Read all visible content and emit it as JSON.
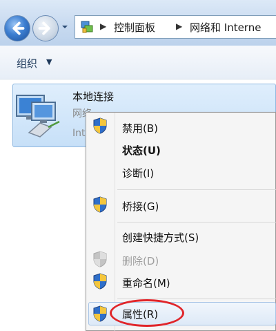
{
  "address_bar": {
    "crumbs": [
      "控制面板",
      "网络和 Interne"
    ]
  },
  "toolbar": {
    "organize_label": "组织"
  },
  "connection": {
    "name": "本地连接",
    "line1": "网络",
    "line2": "Int"
  },
  "context_menu": {
    "items": [
      {
        "label": "禁用(B)",
        "icon": "uac-shield-icon",
        "bold": false,
        "disabled": false
      },
      {
        "label": "状态(U)",
        "icon": "",
        "bold": true,
        "disabled": false
      },
      {
        "label": "诊断(I)",
        "icon": "",
        "bold": false,
        "disabled": false
      },
      {
        "label": "桥接(G)",
        "icon": "uac-shield-icon",
        "bold": false,
        "disabled": false
      },
      {
        "label": "创建快捷方式(S)",
        "icon": "",
        "bold": false,
        "disabled": false
      },
      {
        "label": "删除(D)",
        "icon": "uac-shield-icon",
        "bold": false,
        "disabled": true
      },
      {
        "label": "重命名(M)",
        "icon": "uac-shield-icon",
        "bold": false,
        "disabled": false
      },
      {
        "label": "属性(R)",
        "icon": "uac-shield-icon",
        "bold": false,
        "disabled": false,
        "highlighted": true
      }
    ]
  },
  "colors": {
    "highlight_circle": "#e0252a",
    "selection_tile": "#cfe4fa"
  }
}
